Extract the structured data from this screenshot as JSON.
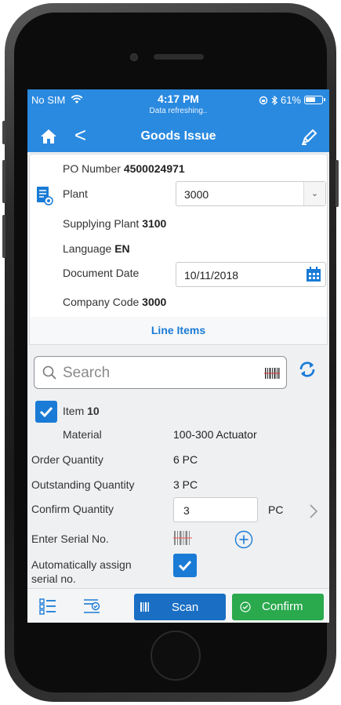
{
  "status": {
    "carrier": "No SIM",
    "time": "4:17 PM",
    "subtitle": "Data refreshing..",
    "battery": "61%",
    "battery_level": 0.61
  },
  "nav": {
    "title": "Goods Issue",
    "back": "<"
  },
  "header": {
    "po_label": "PO Number",
    "po_value": "4500024971",
    "plant_label": "Plant",
    "plant_value": "3000",
    "supplying_label": "Supplying Plant",
    "supplying_value": "3100",
    "language_label": "Language",
    "language_value": "EN",
    "docdate_label": "Document Date",
    "docdate_value": "10/11/2018",
    "company_label": "Company Code",
    "company_value": "3000"
  },
  "line_items_title": "Line Items",
  "search": {
    "placeholder": "Search"
  },
  "item": {
    "label": "Item",
    "number": "10",
    "material_label": "Material",
    "material_value": "100-300 Actuator",
    "order_qty_label": "Order Quantity",
    "order_qty_value": "6  PC",
    "outstanding_label": "Outstanding Quantity",
    "outstanding_value": "3  PC",
    "confirm_label": "Confirm Quantity",
    "confirm_value": "3",
    "confirm_unit": "PC",
    "serial_label": "Enter Serial No.",
    "auto_label_1": "Automatically assign",
    "auto_label_2": "serial no."
  },
  "toolbar": {
    "scan_label": "Scan",
    "confirm_label": "Confirm"
  },
  "colors": {
    "brand": "#2a8ae0",
    "accent": "#1a7bd6",
    "confirm": "#2aa94d"
  }
}
